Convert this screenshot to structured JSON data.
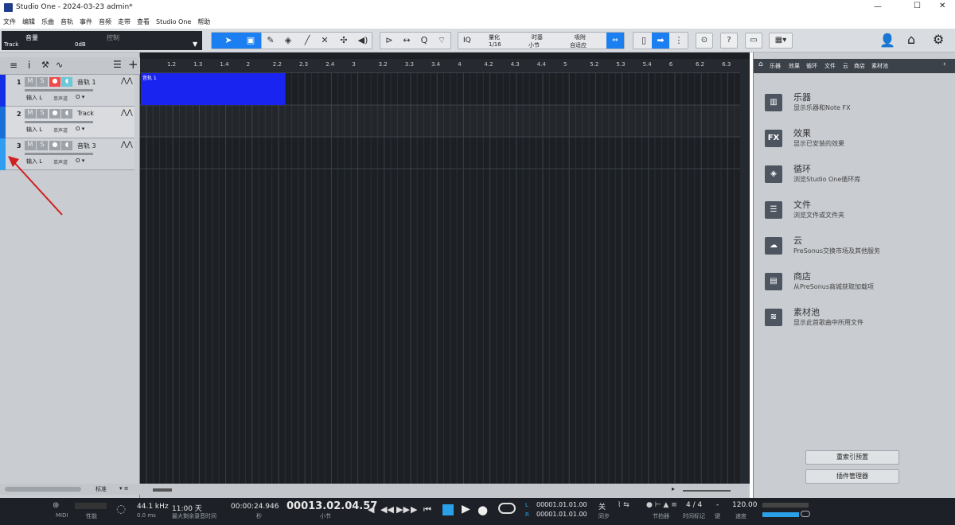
{
  "window": {
    "title": "Studio One - 2024-03-23 admin*",
    "min": "—",
    "max": "☐",
    "close": "✕"
  },
  "menu": [
    "文件",
    "编辑",
    "乐曲",
    "音轨",
    "事件",
    "音频",
    "走带",
    "查看",
    "Studio One",
    "帮助"
  ],
  "inspector": {
    "label": "音量",
    "value": "0dB",
    "tab": "控制",
    "track": "Track"
  },
  "toolbar": {
    "quantize_label": "量化",
    "quantize_value": "1/16",
    "timebase_label": "时基",
    "timebase_value": "小节",
    "snap_label": "吸附",
    "snap_value": "自适应",
    "iq": "IQ",
    "help": "?"
  },
  "tracks": [
    {
      "num": "1",
      "name": "音轨 1",
      "input": "输入 L",
      "mode": "单声道",
      "color": "#1330e8",
      "record": true
    },
    {
      "num": "2",
      "name": "Track",
      "input": "输入 L",
      "mode": "单声道",
      "color": "#1a6fd8",
      "record": false
    },
    {
      "num": "3",
      "name": "音轨 3",
      "input": "输入 L",
      "mode": "单声道",
      "color": "#2f9df0",
      "record": false
    }
  ],
  "track_buttons": {
    "mute": "M",
    "solo": "S"
  },
  "left_footer": {
    "label": "标准"
  },
  "ruler": [
    "1.2",
    "1.3",
    "1.4",
    "2",
    "2.2",
    "2.3",
    "2.4",
    "3",
    "3.2",
    "3.3",
    "3.4",
    "4",
    "4.2",
    "4.3",
    "4.4",
    "5",
    "5.2",
    "5.3",
    "5.4",
    "6",
    "6.2",
    "6.3"
  ],
  "clip": {
    "label": "音轨 1",
    "color": "#1a24f0"
  },
  "browser": {
    "tabs": [
      "乐器",
      "效果",
      "循环",
      "文件",
      "云",
      "商店",
      "素材池"
    ],
    "items": [
      {
        "icon": "instrument-icon",
        "glyph": "▥",
        "title": "乐器",
        "desc": "显示乐器和Note FX"
      },
      {
        "icon": "fx-icon",
        "glyph": "FX",
        "title": "效果",
        "desc": "显示已安装的效果"
      },
      {
        "icon": "loop-icon",
        "glyph": "◈",
        "title": "循环",
        "desc": "浏览Studio One循环库"
      },
      {
        "icon": "file-icon",
        "glyph": "☰",
        "title": "文件",
        "desc": "浏览文件或文件夹"
      },
      {
        "icon": "cloud-icon",
        "glyph": "☁",
        "title": "云",
        "desc": "PreSonus交换市场及其他服务"
      },
      {
        "icon": "shop-icon",
        "glyph": "▤",
        "title": "商店",
        "desc": "从PreSonus商城获取加载项"
      },
      {
        "icon": "pool-icon",
        "glyph": "≋",
        "title": "素材池",
        "desc": "显示此首歌曲中所用文件"
      }
    ],
    "reindex": "重索引预置",
    "plugin_manager": "插件管理器"
  },
  "transport": {
    "midi": "MIDI",
    "perf": "性能",
    "samplerate": "44.1 kHz",
    "latency": "0.0 ms",
    "rec_time": "11:00 天",
    "rec_label": "最大剩余录音时间",
    "time_sec": "00:00:24.946",
    "time_sec_unit": "秒",
    "position": "00013.02.04.57",
    "position_unit": "小节",
    "loop_l": "00001.01.01.00",
    "loop_r": "00001.01.01.00",
    "l": "L",
    "r": "R",
    "sync_value": "关",
    "sync": "同步",
    "metronome": "节拍器",
    "signature_value": "4 / 4",
    "signature": "时间标记",
    "key_value": "-",
    "key": "键",
    "tempo_value": "120.00",
    "tempo": "速度"
  }
}
